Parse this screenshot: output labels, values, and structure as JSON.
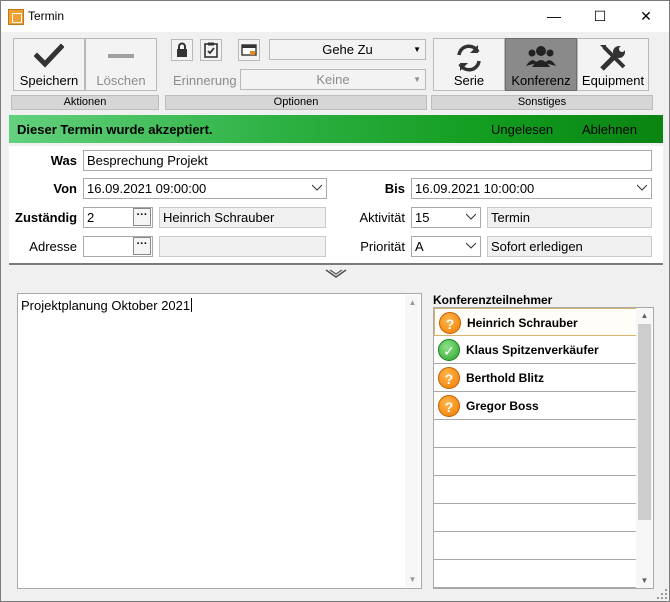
{
  "window": {
    "title": "Termin",
    "minimize_glyph": "—",
    "maximize_glyph": "☐",
    "close_glyph": "✕"
  },
  "toolbar": {
    "groups": {
      "actions": "Aktionen",
      "options": "Optionen",
      "other": "Sonstiges"
    },
    "save_label": "Speichern",
    "delete_label": "Löschen",
    "reminder_label": "Erinnerung",
    "goto_label": "Gehe Zu",
    "reminder_value": "Keine",
    "series_label": "Serie",
    "conference_label": "Konferenz",
    "equipment_label": "Equipment"
  },
  "status": {
    "message": "Dieser Termin wurde akzeptiert.",
    "unread_label": "Ungelesen",
    "decline_label": "Ablehnen",
    "colors": {
      "start": "#63d07d",
      "end": "#0a8412"
    }
  },
  "form": {
    "was_label": "Was",
    "was_value": "Besprechung Projekt",
    "von_label": "Von",
    "von_value": "16.09.2021 09:00:00",
    "bis_label": "Bis",
    "bis_value": "16.09.2021 10:00:00",
    "zustaendig_label": "Zuständig",
    "zustaendig_id": "2",
    "zustaendig_name": "Heinrich Schrauber",
    "aktivitaet_label": "Aktivität",
    "aktivitaet_id": "15",
    "aktivitaet_name": "Termin",
    "adresse_label": "Adresse",
    "adresse_id": "",
    "adresse_name": "",
    "prioritaet_label": "Priorität",
    "prioritaet_id": "A",
    "prioritaet_name": "Sofort erledigen",
    "ellipsis_glyph": "···"
  },
  "notes": {
    "text": "Projektplanung Oktober 2021"
  },
  "participants": {
    "title": "Konferenzteilnehmer",
    "items": [
      {
        "name": "Heinrich Schrauber",
        "status": "question-icon",
        "glyph": "?"
      },
      {
        "name": "Klaus Spitzenverkäufer",
        "status": "check-icon",
        "glyph": "✓"
      },
      {
        "name": "Berthold Blitz",
        "status": "question-icon",
        "glyph": "?"
      },
      {
        "name": "Gregor Boss",
        "status": "question-icon",
        "glyph": "?"
      }
    ]
  }
}
